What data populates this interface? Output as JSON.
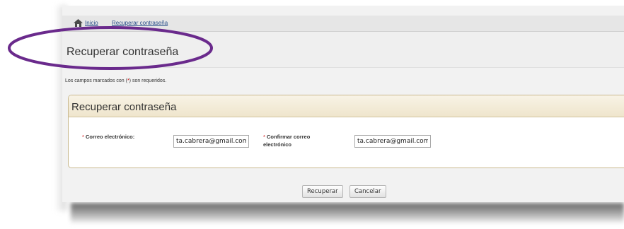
{
  "breadcrumb": {
    "home_label": "Inicio",
    "current_label": "Recuperar contraseña"
  },
  "page": {
    "title": "Recuperar contraseña",
    "required_note_before": "Los campos marcados con (",
    "required_note_mark": "*",
    "required_note_after": ") son requeridos."
  },
  "form": {
    "panel_title": "Recuperar contraseña",
    "required_mark": "*",
    "email_label": "Correo electrónico:",
    "email_value": "ta.cabrera@gmail.com",
    "confirm_label_line1": "Confirmar correo",
    "confirm_label_line2": "electrónico",
    "confirm_value": "ta.cabrera@gmail.com"
  },
  "actions": {
    "submit_label": "Recuperar",
    "cancel_label": "Cancelar"
  },
  "colors": {
    "annotation_ellipse": "#6a2a8c",
    "required_asterisk": "#cc0000",
    "panel_header": "#efe5cc",
    "link": "#2a4f8a"
  },
  "icons": {
    "breadcrumb_home": "home-icon"
  }
}
